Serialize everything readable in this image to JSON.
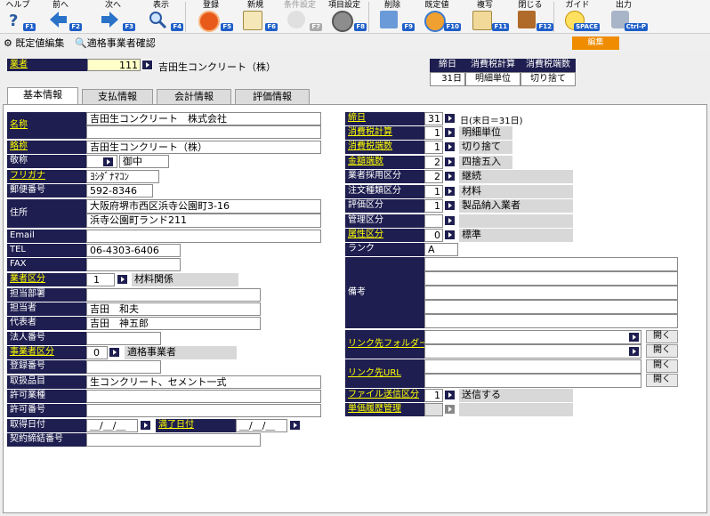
{
  "toolbar": {
    "items": [
      {
        "label": "ヘルプ",
        "key": "F1",
        "icon": "help-icon"
      },
      {
        "label": "前へ",
        "key": "F2",
        "icon": "arrow-left-icon"
      },
      {
        "label": "次へ",
        "key": "F3",
        "icon": "arrow-right-icon"
      },
      {
        "label": "表示",
        "key": "F4",
        "icon": "magnifier-icon"
      },
      {
        "label": "登録",
        "key": "F5",
        "icon": "ok-icon"
      },
      {
        "label": "新規",
        "key": "F6",
        "icon": "new-document-icon"
      },
      {
        "label": "条件設定",
        "key": "F7",
        "icon": "condition-icon"
      },
      {
        "label": "項目設定",
        "key": "F8",
        "icon": "item-settings-icon"
      },
      {
        "label": "削除",
        "key": "F9",
        "icon": "trash-icon"
      },
      {
        "label": "既定値",
        "key": "F10",
        "icon": "default-value-icon"
      },
      {
        "label": "複写",
        "key": "F11",
        "icon": "copy-icon"
      },
      {
        "label": "閉じる",
        "key": "F12",
        "icon": "close-door-icon"
      },
      {
        "label": "ガイド",
        "key": "SPACE",
        "icon": "guide-bulb-icon"
      },
      {
        "label": "出力",
        "key": "Ctrl-P",
        "icon": "print-icon"
      }
    ]
  },
  "subbar": {
    "default_edit": "既定値編集",
    "check": "適格事業者確認",
    "edit_badge": "編集"
  },
  "header": {
    "supplier_label": "業者",
    "supplier_code": "111",
    "supplier_name": "吉田生コンクリート（株）"
  },
  "closing_table": {
    "headers": [
      "締日",
      "消費税計算",
      "消費税端数"
    ],
    "values": [
      "31日",
      "明細単位",
      "切り捨て"
    ]
  },
  "tabs": [
    "基本情報",
    "支払情報",
    "会計情報",
    "評価情報"
  ],
  "left": {
    "name_label": "名称",
    "name1": "吉田生コンクリート　株式会社",
    "name2": "",
    "short_label": "略称",
    "short": "吉田生コンクリート（株）",
    "honorific_label": "敬称",
    "honorific": "御中",
    "kana_label": "フリガナ",
    "kana": "ﾖｼﾀﾞﾅﾏｺﾝ",
    "zip_label": "郵便番号",
    "zip": "592-8346",
    "address_label": "住所",
    "address1": "大阪府堺市西区浜寺公園町3-16",
    "address2": "浜寺公園町ランド211",
    "email_label": "Email",
    "email": "",
    "tel_label": "TEL",
    "tel": "06-4303-6406",
    "fax_label": "FAX",
    "fax": "",
    "category_label": "業者区分",
    "category_code": "1",
    "category_name": "材料関係",
    "dept_label": "担当部署",
    "dept": "",
    "person_label": "担当者",
    "person": "吉田　和夫",
    "rep_label": "代表者",
    "rep": "吉田　神五郎",
    "corp_label": "法人番号",
    "corp": "",
    "biz_label": "事業者区分",
    "biz_code": "0",
    "biz_name": "適格事業者",
    "reg_label": "登録番号",
    "reg": "",
    "items_label": "取扱品目",
    "items": "生コンクリート、セメント一式",
    "permit_type_label": "許可業種",
    "permit_type": "",
    "permit_no_label": "許可番号",
    "permit_no": "",
    "acq_label": "取得日付",
    "acq": "＿/＿/＿",
    "exp_label": "満了日付",
    "exp": "＿/＿/＿",
    "contract_label": "契約締結番号",
    "contract": ""
  },
  "right": {
    "close_label": "締日",
    "close_code": "31",
    "close_text": "日(末日＝31日)",
    "tax_calc_label": "消費税計算",
    "tax_calc_code": "1",
    "tax_calc": "明細単位",
    "tax_round_label": "消費税端数",
    "tax_round_code": "1",
    "tax_round": "切り捨て",
    "amt_round_label": "金額端数",
    "amt_round_code": "2",
    "amt_round": "四捨五入",
    "adopt_label": "業者採用区分",
    "adopt_code": "2",
    "adopt": "継続",
    "order_label": "注文種類区分",
    "order_code": "1",
    "order": "材料",
    "eval_label": "評価区分",
    "eval_code": "1",
    "eval": "製品納入業者",
    "mgmt_label": "管理区分",
    "mgmt_code": "",
    "mgmt": "",
    "attr_label": "属性区分",
    "attr_code": "0",
    "attr": "標準",
    "rank_label": "ランク",
    "rank": "A",
    "remarks_label": "備考",
    "link_folder_label": "リンク先フォルダー",
    "link_url_label": "リンク先URL",
    "open_label": "開く",
    "file_send_label": "ファイル送信区分",
    "file_send_code": "1",
    "file_send": "送信する",
    "price_hist_label": "単価履歴管理"
  }
}
